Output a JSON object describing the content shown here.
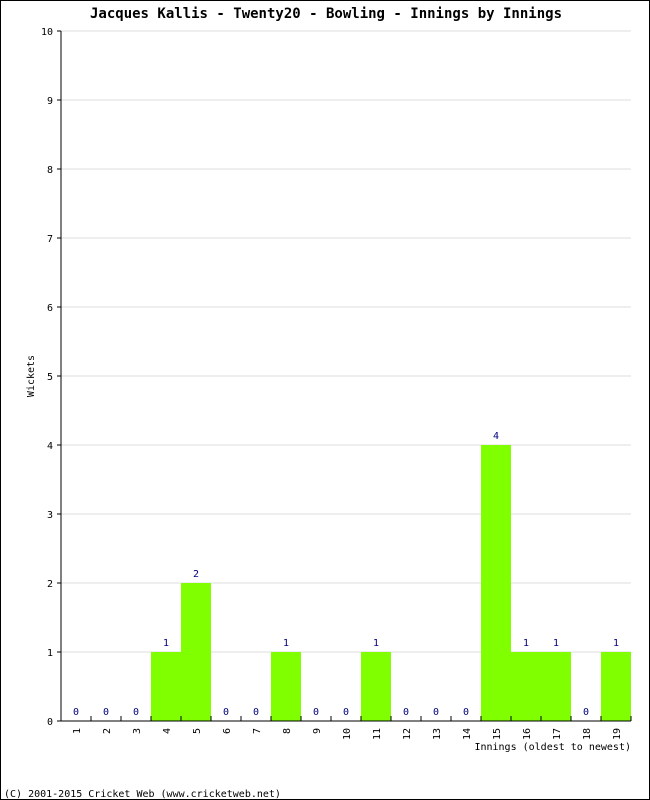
{
  "chart_data": {
    "type": "bar",
    "title": "Jacques Kallis - Twenty20 - Bowling - Innings by Innings",
    "xlabel": "Innings (oldest to newest)",
    "ylabel": "Wickets",
    "ylim": [
      0,
      10
    ],
    "yticks": [
      "0",
      "1",
      "2",
      "3",
      "4",
      "5",
      "6",
      "7",
      "8",
      "9",
      "10"
    ],
    "grid": true,
    "categories": [
      "1",
      "2",
      "3",
      "4",
      "5",
      "6",
      "7",
      "8",
      "9",
      "10",
      "11",
      "12",
      "13",
      "14",
      "15",
      "16",
      "17",
      "18",
      "19"
    ],
    "values": [
      0,
      0,
      0,
      1,
      2,
      0,
      0,
      1,
      0,
      0,
      1,
      0,
      0,
      0,
      4,
      1,
      1,
      0,
      1
    ],
    "bar_color": "#80ff00",
    "label_color": "#000080"
  },
  "footer": "(C) 2001-2015 Cricket Web (www.cricketweb.net)"
}
